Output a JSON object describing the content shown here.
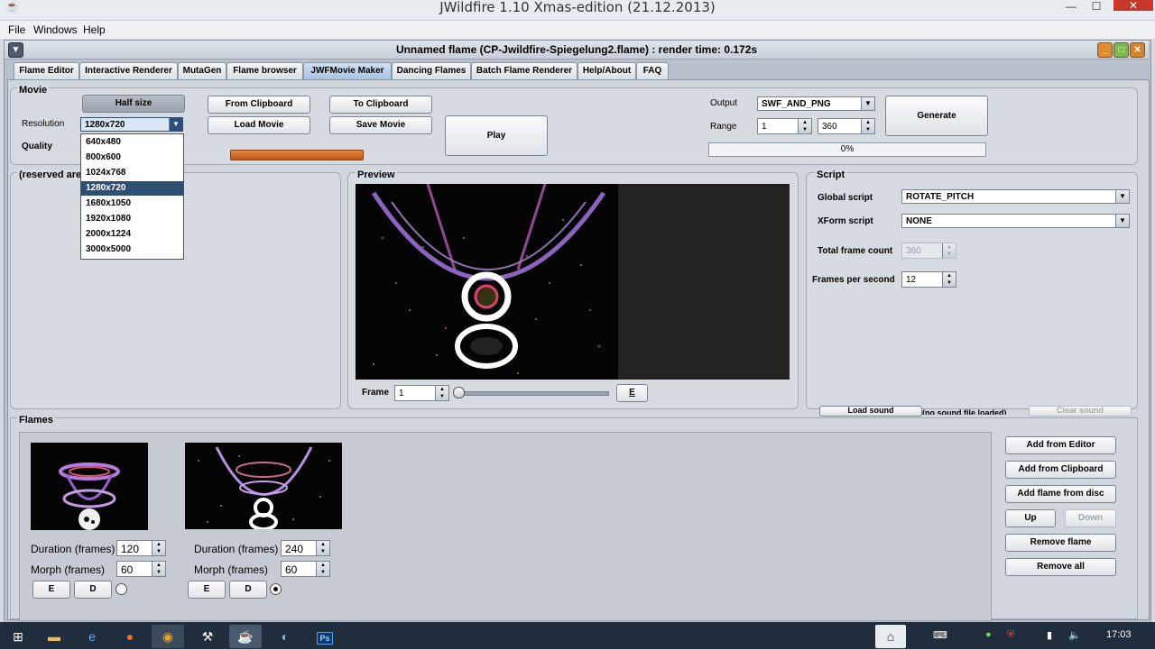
{
  "window": {
    "title": "JWildfire 1.10 Xmas-edition (21.12.2013)"
  },
  "menu": {
    "items": [
      "File",
      "Windows",
      "Help"
    ]
  },
  "inner_frame": {
    "title": "Unnamed flame (CP-Jwildfire-Spiegelung2.flame) : render time: 0.172s"
  },
  "tabs": [
    "Flame Editor",
    "Interactive Renderer",
    "MutaGen",
    "Flame browser",
    "JWFMovie Maker",
    "Dancing Flames",
    "Batch Flame Renderer",
    "Help/About",
    "FAQ"
  ],
  "movie": {
    "title": "Movie",
    "half_size_label": "Half size",
    "resolution_label": "Resolution",
    "resolution_value": "1280x720",
    "quality_label": "Quality",
    "resolution_options": [
      "640x480",
      "800x600",
      "1024x768",
      "1280x720",
      "1680x1050",
      "1920x1080",
      "2000x1224",
      "3000x5000"
    ],
    "from_clipboard": "From Clipboard",
    "load_movie": "Load Movie",
    "to_clipboard": "To Clipboard",
    "save_movie": "Save Movie",
    "play": "Play",
    "output_label": "Output",
    "output_value": "SWF_AND_PNG",
    "range_label": "Range",
    "range_from": "1",
    "range_to": "360",
    "generate": "Generate",
    "progress_text": "0%",
    "progress_value": 0
  },
  "reserved": {
    "title": "(reserved are"
  },
  "preview": {
    "title": "Preview",
    "frame_label": "Frame",
    "frame_value": "1",
    "edit_button": "E"
  },
  "script": {
    "title": "Script",
    "global_label": "Global script",
    "global_value": "ROTATE_PITCH",
    "xform_label": "XForm script",
    "xform_value": "NONE",
    "total_label": "Total frame count",
    "total_value": "360",
    "fps_label": "Frames per second",
    "fps_value": "12",
    "load_sound": "Load sound",
    "sound_status": "(no sound file loaded)",
    "clear_sound": "Clear sound"
  },
  "flames": {
    "title": "Flames",
    "items": [
      {
        "duration_label": "Duration (frames)",
        "duration": "120",
        "morph_label": "Morph (frames)",
        "morph": "60",
        "e": "E",
        "d": "D",
        "selected": false
      },
      {
        "duration_label": "Duration (frames)",
        "duration": "240",
        "morph_label": "Morph (frames)",
        "morph": "60",
        "e": "E",
        "d": "D",
        "selected": true
      }
    ],
    "add_from_editor": "Add from Editor",
    "add_from_clipboard": "Add from Clipboard",
    "add_from_disc": "Add flame from disc",
    "up": "Up",
    "down": "Down",
    "remove_flame": "Remove flame",
    "remove_all": "Remove all"
  },
  "taskbar": {
    "clock": "17:03"
  },
  "colors": {
    "progress_orange": "#d2691e",
    "selected_blue": "#2e4e73",
    "tab_active": "#a9c3e0"
  }
}
